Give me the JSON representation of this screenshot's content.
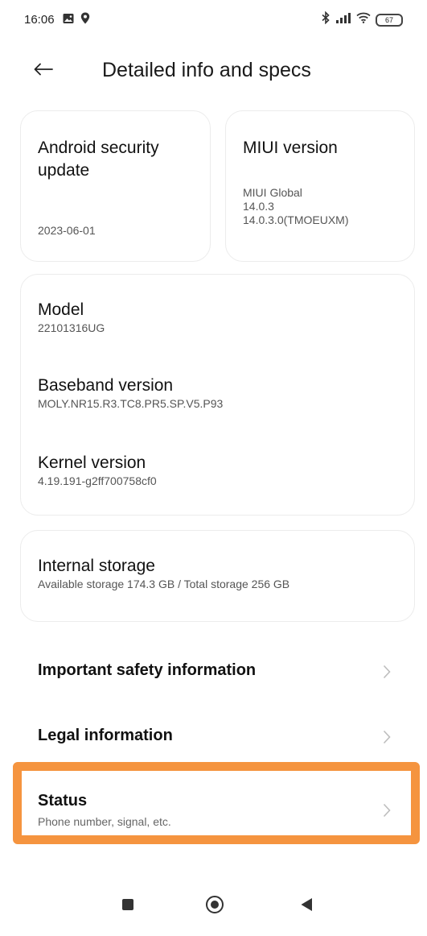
{
  "status_bar": {
    "time": "16:06",
    "battery": "67",
    "left_icons": [
      "gallery-icon",
      "location-icon"
    ],
    "right_icons": [
      "bluetooth-icon",
      "signal-icon",
      "wifi-icon",
      "battery-icon"
    ]
  },
  "header": {
    "title": "Detailed info and specs",
    "back_icon": "arrow-left-icon"
  },
  "cards": {
    "security": {
      "title": "Android security update",
      "value": "2023-06-01"
    },
    "miui": {
      "title": "MIUI version",
      "line1": "MIUI Global",
      "line2": "14.0.3",
      "line3": "14.0.3.0(TMOEUXM)"
    },
    "model": {
      "title": "Model",
      "value": "22101316UG"
    },
    "baseband": {
      "title": "Baseband version",
      "value": "MOLY.NR15.R3.TC8.PR5.SP.V5.P93"
    },
    "kernel": {
      "title": "Kernel version",
      "value": "4.19.191-g2ff700758cf0"
    },
    "storage": {
      "title": "Internal storage",
      "value": "Available storage  174.3 GB / Total storage  256 GB"
    }
  },
  "menu": {
    "safety": {
      "label": "Important safety information"
    },
    "legal": {
      "label": "Legal information"
    },
    "status": {
      "label": "Status",
      "sub": "Phone number, signal, etc."
    }
  },
  "colors": {
    "highlight": "#f5943f",
    "card_border": "#ececec"
  },
  "nav_bar": {
    "icons": [
      "recents-square-icon",
      "home-circle-icon",
      "back-triangle-icon"
    ]
  }
}
